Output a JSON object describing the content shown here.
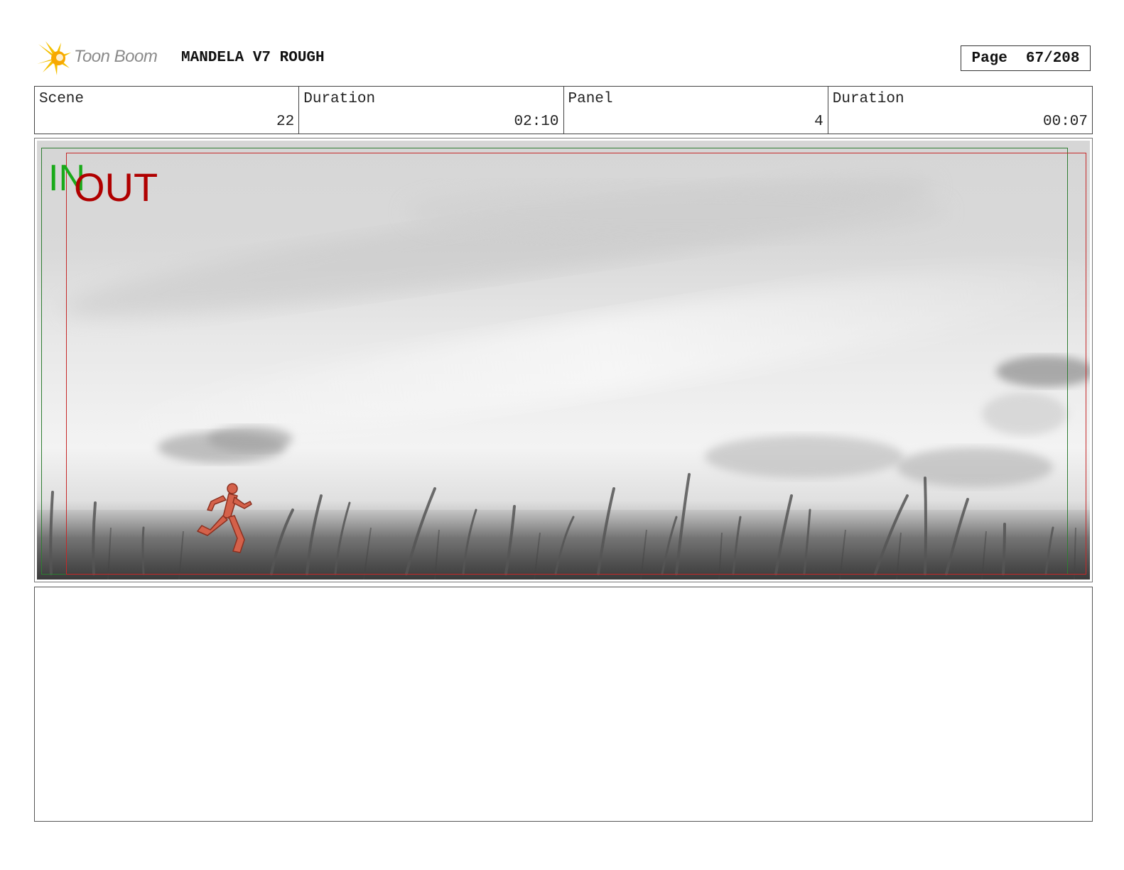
{
  "header": {
    "logo_text": "Toon Boom",
    "project_title": "MANDELA V7 ROUGH",
    "page_label": "Page",
    "page_value": "67/208"
  },
  "info": {
    "scene_label": "Scene",
    "scene_value": "22",
    "scene_duration_label": "Duration",
    "scene_duration_value": "02:10",
    "panel_label": "Panel",
    "panel_value": "4",
    "panel_duration_label": "Duration",
    "panel_duration_value": "00:07"
  },
  "panel": {
    "in_marker": "IN",
    "out_marker": "OUT",
    "safe_in_color": "#2e7d32",
    "safe_out_color": "#c62828",
    "figure_color": "#d4614a"
  },
  "notes": {
    "text": ""
  }
}
